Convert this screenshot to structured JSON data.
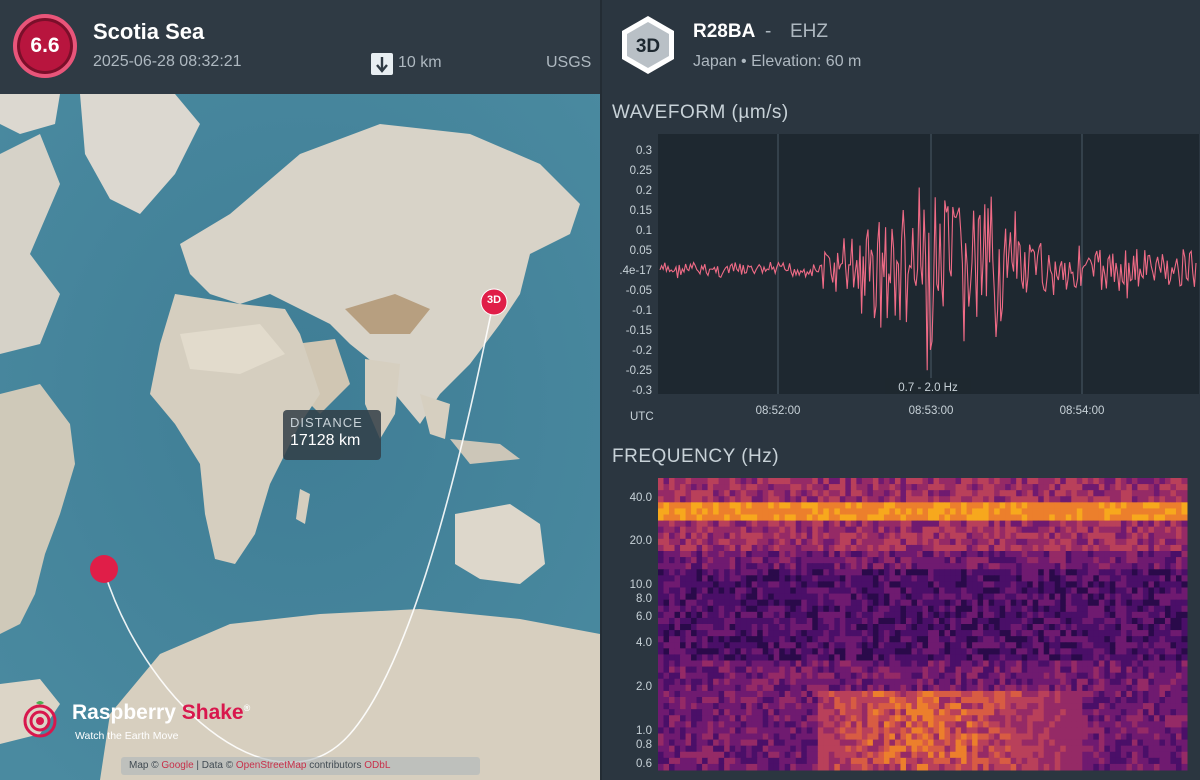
{
  "event": {
    "magnitude": "6.6",
    "name": "Scotia Sea",
    "datetime": "2025-06-28 08:32:21",
    "depth": "10 km",
    "source": "USGS"
  },
  "map": {
    "distance_label": "DISTANCE",
    "distance_value": "17128 km",
    "station_marker_label": "3D",
    "logo_name_1": "Raspberry",
    "logo_name_2": "Shake",
    "logo_tagline": "Watch the Earth Move",
    "attribution": {
      "part1": "Map ©",
      "link1": "Google",
      "part2": "| Data ©",
      "link2": "OpenStreetMap",
      "part3": "contributors",
      "link3": "ODbL"
    }
  },
  "station": {
    "badge": "3D",
    "code": "R28BA",
    "separator": "-",
    "channel": "EHZ",
    "location": "Japan • Elevation: 60 m"
  },
  "waveform": {
    "title": "WAVEFORM (µm/s)",
    "filter_label": "0.7 - 2.0 Hz",
    "utc_label": "UTC",
    "y_ticks": [
      "0.3",
      "0.25",
      "0.2",
      "0.15",
      "0.1",
      "0.05",
      ".4e-17",
      "-0.05",
      "-0.1",
      "-0.15",
      "-0.2",
      "-0.25",
      "-0.3"
    ],
    "x_ticks": [
      "08:52:00",
      "08:53:00",
      "08:54:00"
    ],
    "line_color": "#f06b86",
    "bg_color": "#1e2830"
  },
  "frequency": {
    "title": "FREQUENCY (Hz)",
    "y_ticks": [
      "40.0",
      "20.0",
      "10.0",
      "8.0",
      "6.0",
      "4.0",
      "2.0",
      "1.0",
      "0.8",
      "0.6"
    ]
  },
  "colors": {
    "magnitude_badge": "#b8153e",
    "marker": "#e01e48",
    "brand": "#d8174d"
  }
}
